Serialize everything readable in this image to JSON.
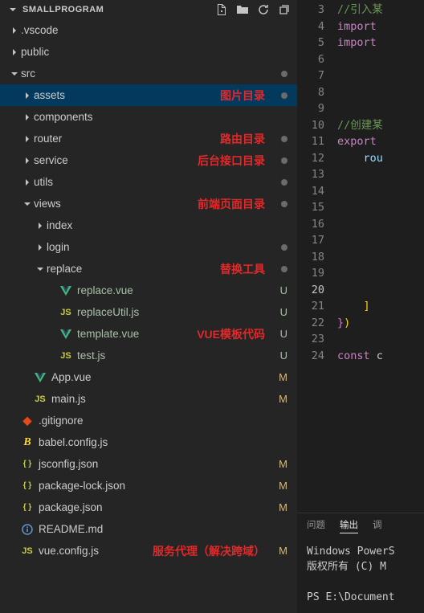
{
  "explorer": {
    "title": "SMALLPROGRAM",
    "items": [
      {
        "type": "folder",
        "name": ".vscode",
        "depth": 2,
        "open": false
      },
      {
        "type": "folder",
        "name": "public",
        "depth": 2,
        "open": false
      },
      {
        "type": "folder",
        "name": "src",
        "depth": 2,
        "open": true,
        "badge": true
      },
      {
        "type": "folder",
        "name": "assets",
        "depth": 3,
        "open": false,
        "selected": true,
        "annotation": "图片目录",
        "badge": true
      },
      {
        "type": "folder",
        "name": "components",
        "depth": 3,
        "open": false
      },
      {
        "type": "folder",
        "name": "router",
        "depth": 3,
        "open": false,
        "annotation": "路由目录",
        "badge": true
      },
      {
        "type": "folder",
        "name": "service",
        "depth": 3,
        "open": false,
        "annotation": "后台接口目录",
        "badge": true
      },
      {
        "type": "folder",
        "name": "utils",
        "depth": 3,
        "open": false,
        "badge": true
      },
      {
        "type": "folder",
        "name": "views",
        "depth": 3,
        "open": true,
        "annotation": "前端页面目录",
        "badge": true
      },
      {
        "type": "folder",
        "name": "index",
        "depth": 4,
        "open": false
      },
      {
        "type": "folder",
        "name": "login",
        "depth": 4,
        "open": false,
        "badge": true
      },
      {
        "type": "folder",
        "name": "replace",
        "depth": 4,
        "open": true,
        "annotation": "替换工具",
        "badge": true
      },
      {
        "type": "file",
        "name": "replace.vue",
        "icon": "vue",
        "depth": 5,
        "git": "U",
        "untracked": true
      },
      {
        "type": "file",
        "name": "replaceUtil.js",
        "icon": "js",
        "depth": 5,
        "git": "U",
        "untracked": true
      },
      {
        "type": "file",
        "name": "template.vue",
        "icon": "vue",
        "depth": 5,
        "annotation": "VUE模板代码",
        "git": "U",
        "untracked": true
      },
      {
        "type": "file",
        "name": "test.js",
        "icon": "js",
        "depth": 5,
        "git": "U",
        "untracked": true
      },
      {
        "type": "file",
        "name": "App.vue",
        "icon": "vue",
        "depth": 3,
        "git": "M",
        "modified": true
      },
      {
        "type": "file",
        "name": "main.js",
        "icon": "js",
        "depth": 3,
        "git": "M",
        "modified": true
      },
      {
        "type": "file",
        "name": ".gitignore",
        "icon": "git",
        "depth": 2
      },
      {
        "type": "file",
        "name": "babel.config.js",
        "icon": "babel",
        "depth": 2
      },
      {
        "type": "file",
        "name": "jsconfig.json",
        "icon": "json",
        "depth": 2,
        "git": "M",
        "modified": true
      },
      {
        "type": "file",
        "name": "package-lock.json",
        "icon": "json",
        "depth": 2,
        "git": "M",
        "modified": true
      },
      {
        "type": "file",
        "name": "package.json",
        "icon": "json",
        "depth": 2,
        "git": "M",
        "modified": true
      },
      {
        "type": "file",
        "name": "README.md",
        "icon": "info",
        "depth": 2
      },
      {
        "type": "file",
        "name": "vue.config.js",
        "icon": "js",
        "depth": 2,
        "annotation": "服务代理（解决跨域）",
        "git": "M",
        "modified": true
      }
    ]
  },
  "editor": {
    "line_start": 3,
    "current_line": 20,
    "lines": [
      "//引入某",
      "import ",
      "import ",
      "",
      "",
      "",
      "",
      "//创建某",
      "export ",
      "    rou",
      "",
      "",
      "",
      "",
      "",
      "",
      "",
      "",
      "    ]",
      "})",
      "",
      "const c"
    ]
  },
  "panel": {
    "tabs": [
      "问题",
      "输出",
      "调"
    ],
    "active": 1,
    "terminal": "Windows PowerS\n版权所有 (C) M\n\nPS E:\\Document"
  }
}
